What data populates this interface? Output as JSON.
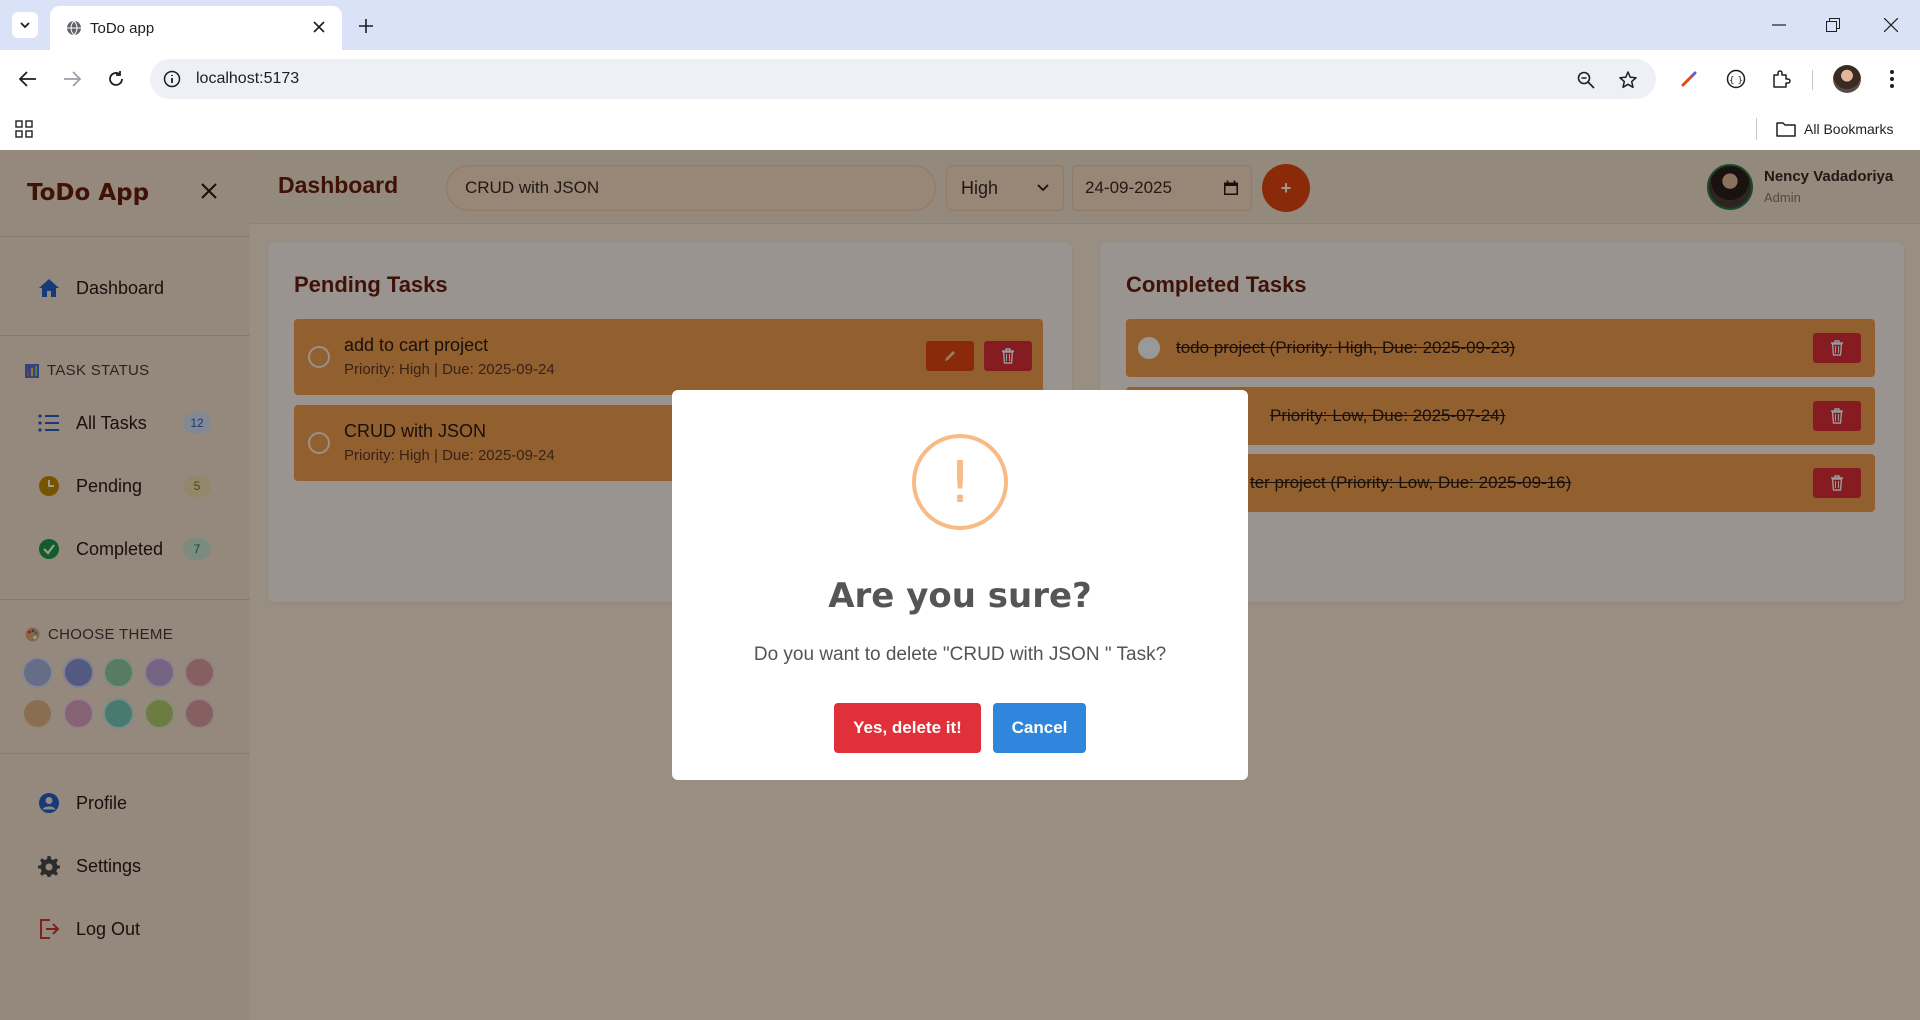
{
  "browser": {
    "tab_title": "ToDo app",
    "url": "localhost:5173",
    "bookmarks_label": "All Bookmarks"
  },
  "sidebar": {
    "brand": "ToDo App",
    "nav": [
      {
        "label": "Dashboard",
        "icon": "home-icon"
      }
    ],
    "task_status_title": "TASK STATUS",
    "status_items": [
      {
        "label": "All Tasks",
        "count": "12",
        "icon": "list-icon"
      },
      {
        "label": "Pending",
        "count": "5",
        "icon": "clock-icon"
      },
      {
        "label": "Completed",
        "count": "7",
        "icon": "check-circle-icon"
      }
    ],
    "theme_title": "CHOOSE THEME",
    "theme_colors": [
      "#a9b8e0",
      "#8b96d9",
      "#93cfa2",
      "#c5a7dc",
      "#e0a0a0",
      "#e8b888",
      "#e0a3c4",
      "#78cbbb",
      "#b8cf70",
      "#e0a0a0"
    ],
    "bottom_items": [
      {
        "label": "Profile",
        "icon": "user-icon"
      },
      {
        "label": "Settings",
        "icon": "gear-icon"
      },
      {
        "label": "Log Out",
        "icon": "logout-icon"
      }
    ]
  },
  "header": {
    "title": "Dashboard",
    "task_input_value": "CRUD with JSON",
    "priority_value": "High",
    "date_value": "24-09-2025",
    "add_label": "+",
    "user_name": "Nency Vadadoriya",
    "user_role": "Admin"
  },
  "pending": {
    "title": "Pending Tasks",
    "tasks": [
      {
        "title": "add to cart project",
        "meta": "Priority: High | Due: 2025-09-24"
      },
      {
        "title": "CRUD with JSON",
        "meta": "Priority: High | Due: 2025-09-24"
      }
    ]
  },
  "completed": {
    "title": "Completed Tasks",
    "tasks": [
      {
        "text": "todo project (Priority: High, Due: 2025-09-23)"
      },
      {
        "text": "Priority: Low, Due: 2025-07-24)"
      },
      {
        "text": "ter project (Priority: Low, Due: 2025-09-16)"
      }
    ]
  },
  "modal": {
    "icon": "!",
    "title": "Are you sure?",
    "text": "Do you want to delete \"CRUD with JSON \" Task?",
    "confirm_label": "Yes, delete it!",
    "cancel_label": "Cancel"
  },
  "colors": {
    "accent": "#e8470f",
    "danger": "#e0303a",
    "primary": "#2f86dd",
    "card": "#f4a04f",
    "heading": "#6b1d0c"
  }
}
